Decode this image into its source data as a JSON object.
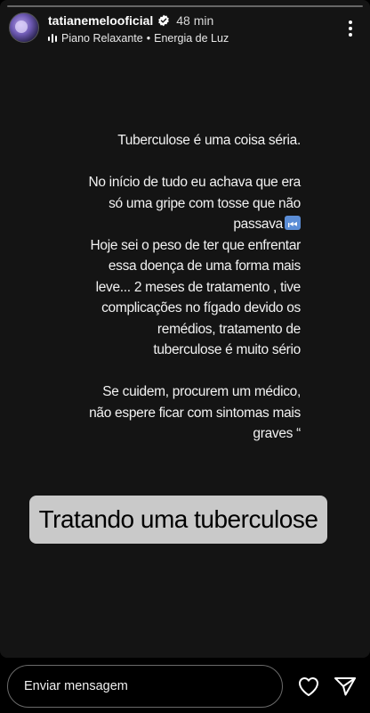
{
  "header": {
    "username": "tatianemelooficial",
    "time": "48 min",
    "music_title": "Piano Relaxante",
    "music_separator": "•",
    "music_artist": "Energia de Luz"
  },
  "story": {
    "progress": 0.0,
    "caption_lines": [
      "Tuberculose é uma coisa séria.",
      "",
      "No início de tudo eu achava que era",
      "só uma gripe com tosse que não",
      "passava",
      "Hoje sei o peso de ter que enfrentar",
      "essa doença de uma forma mais",
      "leve...  2 meses de tratamento , tive",
      "complicações no fígado devido os",
      "remédios, tratamento de",
      "tuberculose é muito sério",
      "",
      "Se cuidem, procurem um médico,",
      "não espere ficar com sintomas mais",
      "graves “"
    ],
    "sticker_text": "Tratando uma tuberculose"
  },
  "footer": {
    "reply_placeholder": "Enviar mensagem"
  },
  "colors": {
    "background": "#000000",
    "story_background": "#141414",
    "sticker_background": "#c9c9c9"
  },
  "icons": {
    "verified": "verified-badge-icon",
    "music": "audio-bars-icon",
    "more": "more-vertical-icon",
    "like": "heart-icon",
    "share": "send-icon"
  }
}
